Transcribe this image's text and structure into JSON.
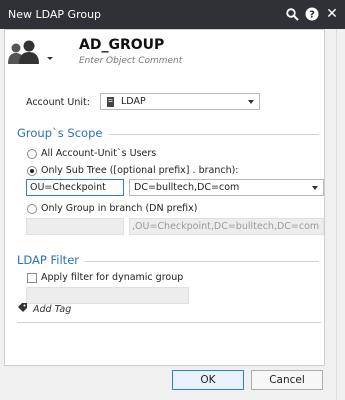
{
  "window": {
    "title": "New LDAP Group"
  },
  "header": {
    "name": "AD_GROUP",
    "comment_placeholder": "Enter Object Comment"
  },
  "account_unit": {
    "label": "Account Unit:",
    "value": "LDAP"
  },
  "scope": {
    "title": "Group`s Scope",
    "options": [
      "All Account-Unit`s Users",
      "Only Sub Tree ([optional prefix] . branch):",
      "Only Group in branch (DN prefix)"
    ],
    "selected_option": 1,
    "prefix_value": "OU=Checkpoint",
    "branch_value": "DC=bulltech,DC=com",
    "dn_value": ",OU=Checkpoint,DC=bulltech,DC=com"
  },
  "ldap_filter": {
    "title": "LDAP Filter",
    "checkbox_label": "Apply filter for dynamic group",
    "checked": false
  },
  "add_tag": {
    "label": "Add Tag"
  },
  "buttons": {
    "ok": "OK",
    "cancel": "Cancel"
  }
}
